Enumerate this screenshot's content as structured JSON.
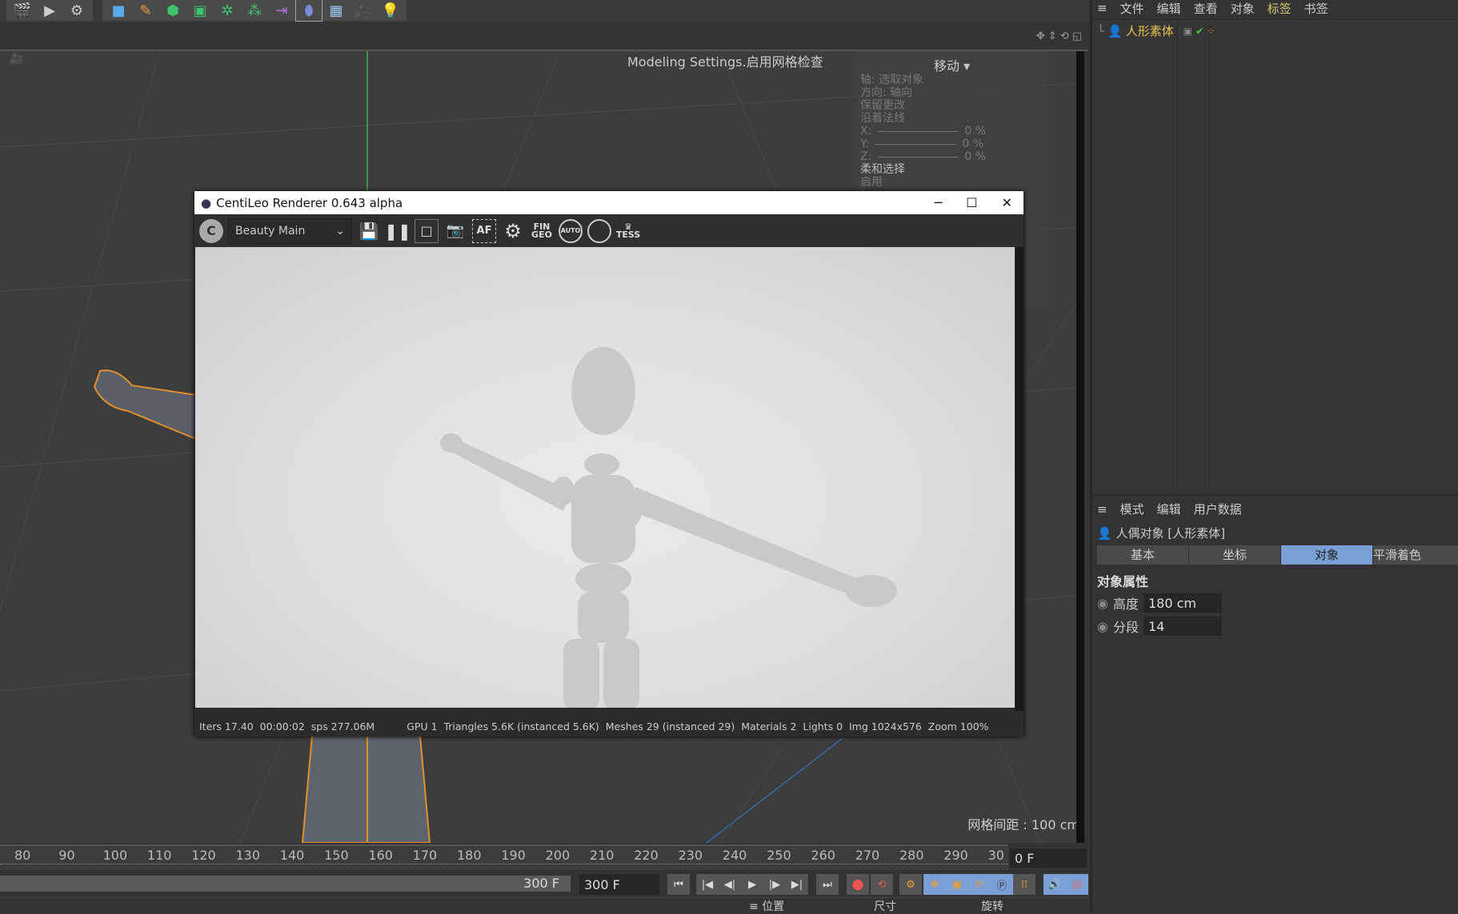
{
  "toolbar": {
    "icons": [
      "render-view-icon",
      "render-picture-viewer-icon",
      "render-settings-icon",
      "cube-icon",
      "pen-icon",
      "subdivision-icon",
      "extrude-icon",
      "cloner-icon",
      "array-icon",
      "symmetry-icon",
      "deformer-icon",
      "floor-icon",
      "camera-icon",
      "light-icon"
    ]
  },
  "viewport": {
    "overlay": "Modeling Settings.启用网格检查",
    "hud": {
      "title": "移动",
      "axis": "轴: 选取对象",
      "direction": "方向: 轴向",
      "keep": "保留更改",
      "normal": "沿着法线",
      "x_label": "X:",
      "y_label": "Y:",
      "z_label": "Z:",
      "x_value": "0 %",
      "y_value": "0 %",
      "z_value": "0 %",
      "soft": "柔和选择",
      "enable": "启用"
    },
    "grid_spacing": "网格间距 : 100 cm"
  },
  "renderer": {
    "title": "CentiLeo Renderer 0.643 alpha",
    "pass": "Beauty Main",
    "buttons": {
      "fin": "FIN",
      "geo": "GEO",
      "auto": "AUTO",
      "tess": "TESS",
      "af": "AF"
    },
    "status": {
      "iters": "Iters 17.40",
      "time": "00:00:02",
      "sps": "sps 277.06M",
      "gpu": "GPU 1",
      "triangles": "Triangles 5.6K (instanced 5.6K)",
      "meshes": "Meshes 29 (instanced 29)",
      "materials": "Materials 2",
      "lights": "Lights 0",
      "img": "Img 1024x576",
      "zoom": "Zoom 100%"
    }
  },
  "timeline": {
    "ticks": [
      "80",
      "90",
      "100",
      "110",
      "120",
      "130",
      "140",
      "150",
      "160",
      "170",
      "180",
      "190",
      "200",
      "210",
      "220",
      "230",
      "240",
      "250",
      "260",
      "270",
      "280",
      "290",
      "30"
    ],
    "current_frame": "0 F",
    "end_label": "300 F",
    "end_field": "300 F"
  },
  "coords": {
    "position": "位置",
    "size": "尺寸",
    "rotation": "旋转"
  },
  "objects": {
    "menu": [
      "文件",
      "编辑",
      "查看",
      "对象",
      "标签",
      "书签"
    ],
    "active_menu": "标签",
    "item": "人形素体"
  },
  "attributes": {
    "menu": [
      "模式",
      "编辑",
      "用户数据"
    ],
    "object_title": "人偶对象 [人形素体]",
    "tabs": [
      "基本",
      "坐标",
      "对象",
      "平滑着色"
    ],
    "active_tab": "对象",
    "section": "对象属性",
    "height_label": "高度",
    "height_value": "180 cm",
    "segments_label": "分段",
    "segments_value": "14"
  },
  "colors": {
    "accent": "#7a9ed6",
    "selected_text": "#e8c24a",
    "axis_green": "#3fae5a"
  }
}
